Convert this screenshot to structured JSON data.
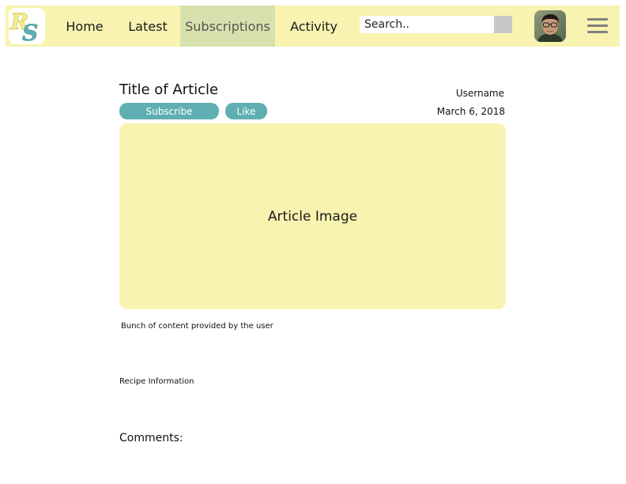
{
  "logo": {
    "letters": "RS",
    "alt_name": "logo"
  },
  "nav": {
    "items": [
      {
        "label": "Home"
      },
      {
        "label": "Latest"
      },
      {
        "label": "Subscriptions",
        "active": true
      },
      {
        "label": "Activity"
      }
    ],
    "search_placeholder": "Search.."
  },
  "colors": {
    "nav_background": "#f8f3b0",
    "nav_active": "#d7e1ad",
    "accent_button": "#5fafb2",
    "image_placeholder": "#f8f3b0",
    "search_button": "#c8c8c8",
    "menu_icon": "#808080"
  },
  "icons": {
    "menu": "hamburger-menu-icon",
    "avatar": "user-avatar"
  },
  "article": {
    "title": "Title of Article",
    "subscribe_label": "Subscribe",
    "like_label": "Like",
    "username": "Username",
    "date": "March 6, 2018",
    "image_label": "Article Image",
    "content": "Bunch of content provided by the user",
    "recipe_info": "Recipe Information",
    "comments_heading": "Comments:"
  }
}
